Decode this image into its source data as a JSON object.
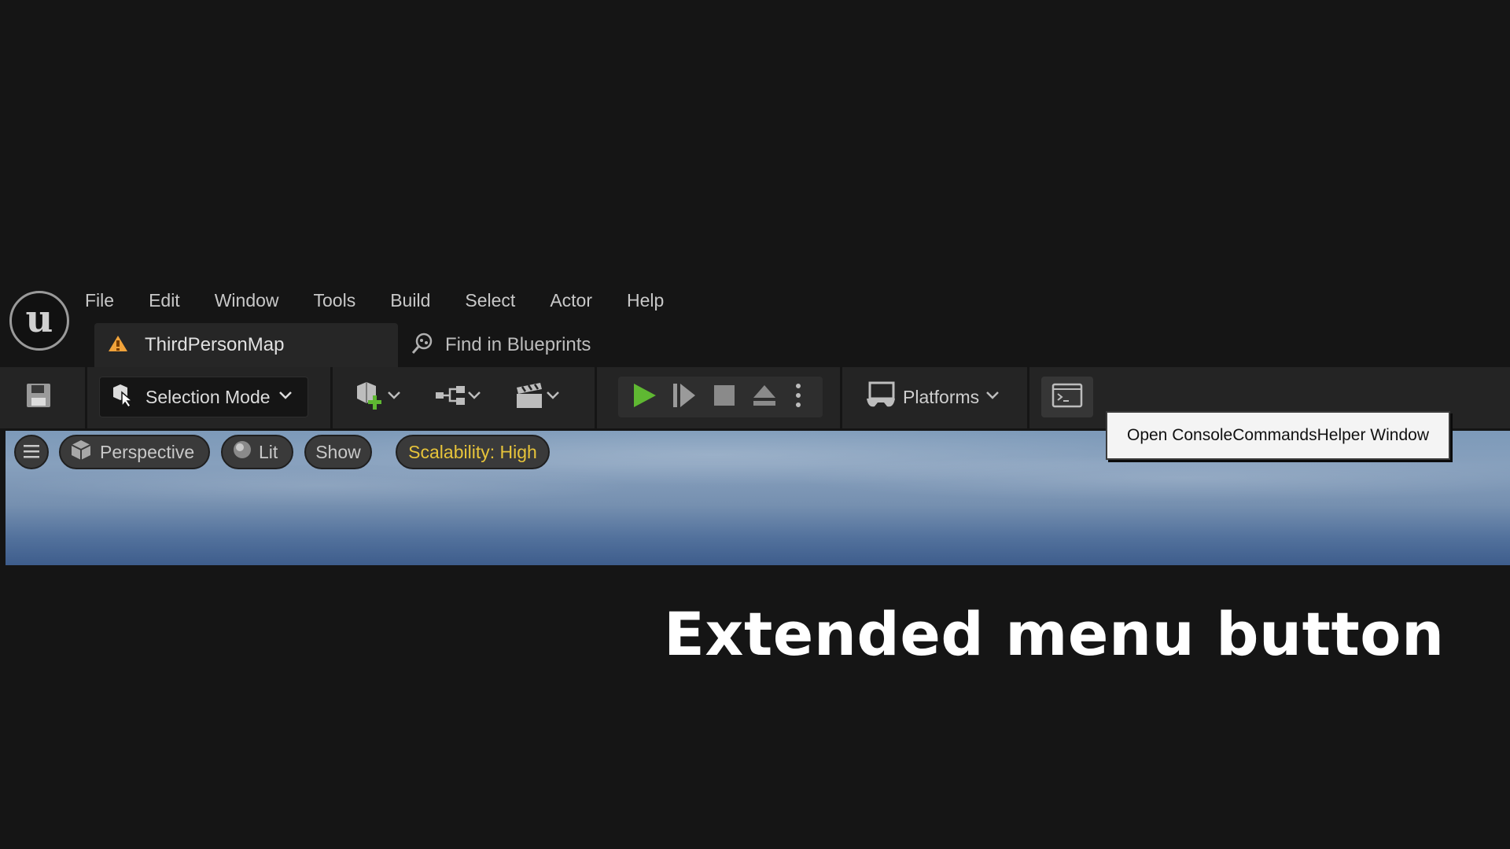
{
  "menu": [
    "File",
    "Edit",
    "Window",
    "Tools",
    "Build",
    "Select",
    "Actor",
    "Help"
  ],
  "tabs": {
    "map_tab_label": "ThirdPersonMap",
    "find_tab_label": "Find in Blueprints"
  },
  "toolbar": {
    "selection_mode_label": "Selection Mode",
    "platforms_label": "Platforms"
  },
  "viewport": {
    "perspective_label": "Perspective",
    "lit_label": "Lit",
    "show_label": "Show",
    "scalability_label": "Scalability: High"
  },
  "tooltip": "Open ConsoleCommandsHelper Window",
  "caption": "Extended menu button",
  "colors": {
    "play_green": "#5fb832",
    "scalability_yellow": "#e7c43a",
    "warning_orange": "#f0a23a"
  }
}
